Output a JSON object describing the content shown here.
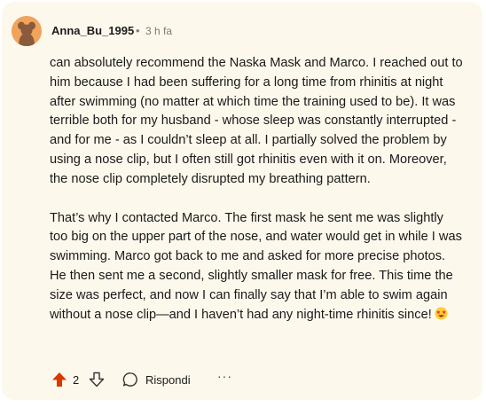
{
  "comment": {
    "author": "Anna_Bu_1995",
    "separator": "•",
    "time": "3 h fa",
    "paragraphs": [
      "can absolutely recommend the Naska Mask and Marco. I reached out to him because I had been suffering for a long time from rhinitis at night after swimming (no matter at which time the training used to be). It was terrible both for my husband - whose sleep was constantly interrupted - and for me - as I couldn’t sleep at all. I partially solved the problem by using a nose clip, but I often still got rhinitis even with it on. Moreover, the nose clip completely disrupted my breathing pattern.",
      "That’s why I contacted Marco. The first mask he sent me was slightly too big on the upper part of the nose, and water would get in while I was swimming. Marco got back to me and asked for more precise photos. He then sent me a second, slightly smaller mask for free. This time the size was perfect, and now I can finally say that I’m able to swim again without a nose clip—and I haven’t had any night-time rhinitis since!"
    ],
    "emoji": "star-struck-emoji"
  },
  "actions": {
    "upvote_icon": "upvote-arrow-icon",
    "score": "2",
    "downvote_icon": "downvote-arrow-icon",
    "reply_icon": "speech-bubble-icon",
    "reply_label": "Rispondi",
    "more_label": "···"
  },
  "colors": {
    "card_background": "#fdf8ec",
    "upvote_active": "#d93900",
    "avatar": "#f0a45b",
    "meta_text": "#7c7c7c"
  }
}
